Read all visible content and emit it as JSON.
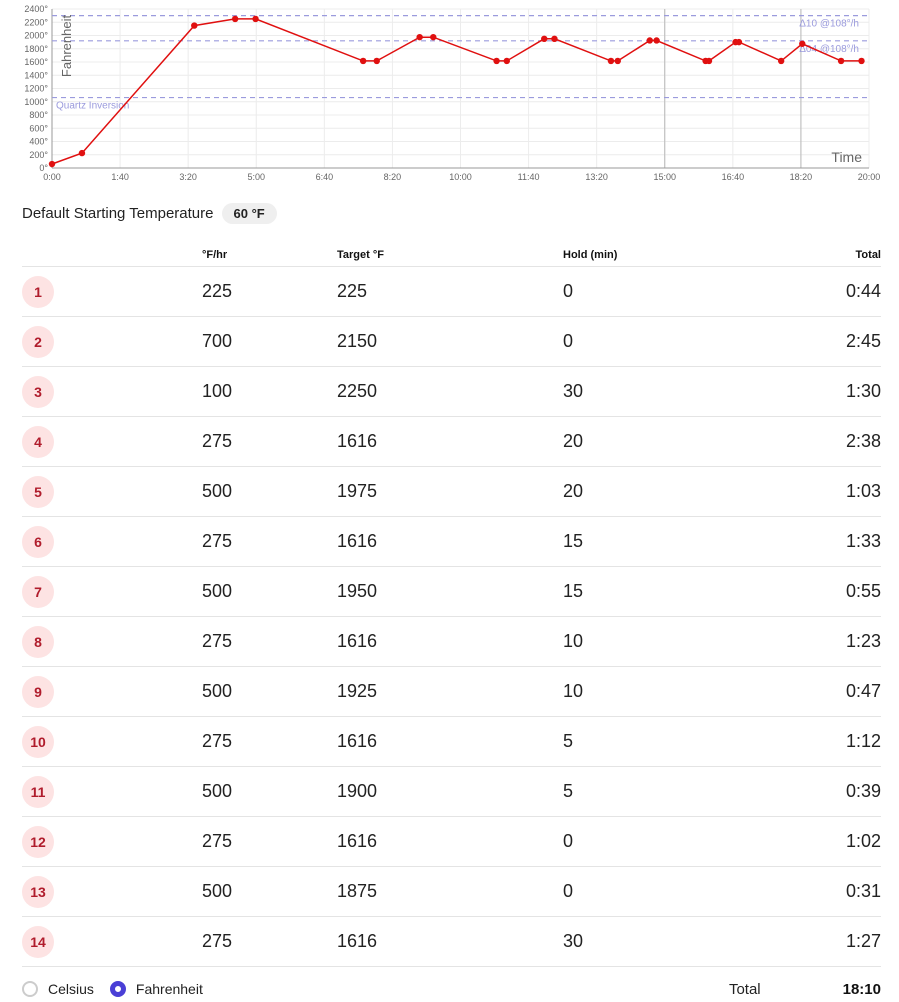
{
  "colors": {
    "line": "#e01010",
    "guide": "#9b9bdd",
    "badge_bg": "#fde3e3",
    "badge_text": "#b01c2c",
    "radio_on": "#4a3fd6"
  },
  "chart_data": {
    "type": "line",
    "ylabel": "Fahrenheit",
    "xlabel": "Time",
    "y_ticks": [
      "0°",
      "200°",
      "400°",
      "600°",
      "800°",
      "1000°",
      "1200°",
      "1400°",
      "1600°",
      "1800°",
      "2000°",
      "2200°",
      "2400°"
    ],
    "x_ticks": [
      "0:00",
      "1:40",
      "3:20",
      "5:00",
      "6:40",
      "8:20",
      "10:00",
      "11:40",
      "13:20",
      "15:00",
      "16:40",
      "18:20",
      "20:00"
    ],
    "ylim": [
      0,
      2400
    ],
    "xlim_minutes": [
      0,
      1200
    ],
    "guides": [
      {
        "y": 2300,
        "label": "Δ10 @108°/h"
      },
      {
        "y": 1920,
        "label": "Δ04 @108°/h"
      },
      {
        "y": 1063,
        "label": "Quartz Inversion"
      }
    ],
    "vertical_lines_minutes": [
      900,
      1100
    ],
    "points_minutes": [
      [
        0,
        60
      ],
      [
        44,
        225
      ],
      [
        209,
        2150
      ],
      [
        269,
        2250
      ],
      [
        299,
        2250
      ],
      [
        457,
        1616
      ],
      [
        477,
        1616
      ],
      [
        540,
        1975
      ],
      [
        560,
        1975
      ],
      [
        653,
        1616
      ],
      [
        668,
        1616
      ],
      [
        723,
        1950
      ],
      [
        738,
        1950
      ],
      [
        821,
        1616
      ],
      [
        831,
        1616
      ],
      [
        878,
        1925
      ],
      [
        888,
        1925
      ],
      [
        960,
        1616
      ],
      [
        965,
        1616
      ],
      [
        1004,
        1900
      ],
      [
        1009,
        1900
      ],
      [
        1071,
        1616
      ],
      [
        1102,
        1875
      ],
      [
        1159,
        1616
      ],
      [
        1189,
        1616
      ]
    ]
  },
  "start": {
    "label": "Default Starting Temperature",
    "value": "60 °F"
  },
  "table": {
    "headers": [
      "",
      "°F/hr",
      "Target °F",
      "Hold (min)",
      "Total"
    ],
    "rows": [
      [
        "1",
        "225",
        "225",
        "0",
        "0:44"
      ],
      [
        "2",
        "700",
        "2150",
        "0",
        "2:45"
      ],
      [
        "3",
        "100",
        "2250",
        "30",
        "1:30"
      ],
      [
        "4",
        "275",
        "1616",
        "20",
        "2:38"
      ],
      [
        "5",
        "500",
        "1975",
        "20",
        "1:03"
      ],
      [
        "6",
        "275",
        "1616",
        "15",
        "1:33"
      ],
      [
        "7",
        "500",
        "1950",
        "15",
        "0:55"
      ],
      [
        "8",
        "275",
        "1616",
        "10",
        "1:23"
      ],
      [
        "9",
        "500",
        "1925",
        "10",
        "0:47"
      ],
      [
        "10",
        "275",
        "1616",
        "5",
        "1:12"
      ],
      [
        "11",
        "500",
        "1900",
        "5",
        "0:39"
      ],
      [
        "12",
        "275",
        "1616",
        "0",
        "1:02"
      ],
      [
        "13",
        "500",
        "1875",
        "0",
        "0:31"
      ],
      [
        "14",
        "275",
        "1616",
        "30",
        "1:27"
      ]
    ]
  },
  "footer": {
    "celsius_label": "Celsius",
    "fahrenheit_label": "Fahrenheit",
    "selected": "Fahrenheit",
    "total_label": "Total",
    "total_value": "18:10"
  }
}
